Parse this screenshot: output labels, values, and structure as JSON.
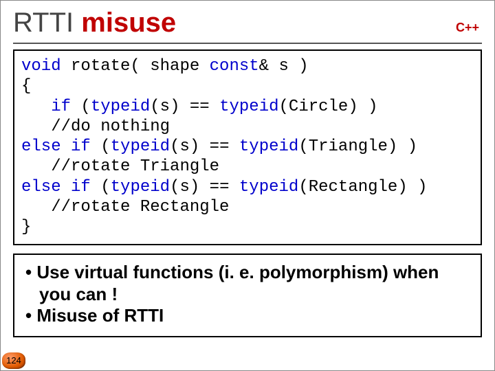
{
  "header": {
    "title_plain": "RTTI ",
    "title_accent": "misuse",
    "lang": "C++"
  },
  "code": {
    "l1a": "void",
    "l1b": " rotate( shape ",
    "l1c": "const",
    "l1d": "& s )",
    "l2": "{",
    "l3a": "   ",
    "l3b": "if",
    "l3c": " (",
    "l3d": "typeid",
    "l3e": "(s) == ",
    "l3f": "typeid",
    "l3g": "(Circle) )",
    "l4": "   //do nothing",
    "l5a": "else",
    "l5b": " ",
    "l5c": "if",
    "l5d": " (",
    "l5e": "typeid",
    "l5f": "(s) == ",
    "l5g": "typeid",
    "l5h": "(Triangle) )",
    "l6": "   //rotate Triangle",
    "l7a": "else",
    "l7b": " ",
    "l7c": "if",
    "l7d": " (",
    "l7e": "typeid",
    "l7f": "(s) == ",
    "l7g": "typeid",
    "l7h": "(Rectangle) )",
    "l8": "   //rotate Rectangle",
    "l9": "}"
  },
  "notes": {
    "b1_line1": "• Use virtual functions (i. e. polymorphism) when",
    "b1_line2": "you can !",
    "b2": "• Misuse of RTTI"
  },
  "page": "124"
}
